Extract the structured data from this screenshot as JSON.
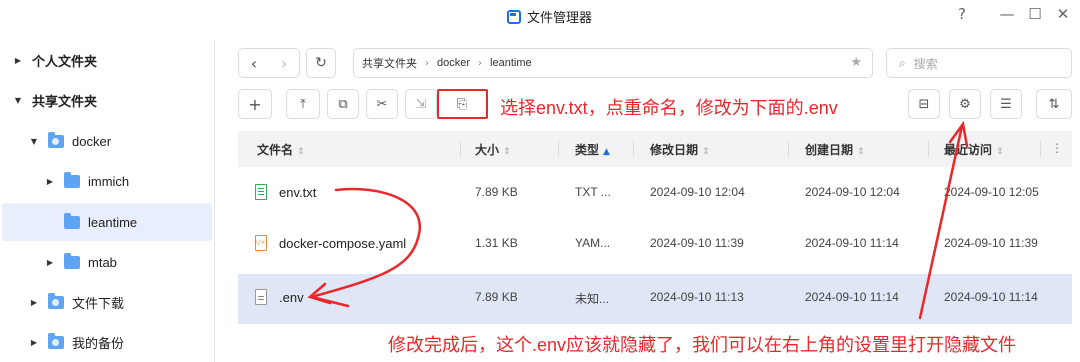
{
  "window": {
    "title": "文件管理器",
    "controls": [
      "?",
      "—",
      "☐",
      "✕"
    ]
  },
  "sidebar": {
    "items": [
      {
        "label": "个人文件夹",
        "arrow": "▶",
        "icon": "none"
      },
      {
        "label": "共享文件夹",
        "arrow": "▼",
        "icon": "none"
      },
      {
        "label": "docker",
        "arrow": "▼",
        "icon": "shared-folder-icon"
      },
      {
        "label": "immich",
        "arrow": "▶",
        "icon": "folder-icon"
      },
      {
        "label": "leantime",
        "arrow": "",
        "icon": "folder-icon"
      },
      {
        "label": "mtab",
        "arrow": "▶",
        "icon": "folder-icon"
      },
      {
        "label": "文件下载",
        "arrow": "▶",
        "icon": "shared-folder-icon"
      },
      {
        "label": "我的备份",
        "arrow": "▶",
        "icon": "shared-folder-icon"
      }
    ]
  },
  "nav": {
    "back": "‹",
    "forward": "›",
    "refresh": "↻"
  },
  "breadcrumb": {
    "items": [
      "共享文件夹",
      "docker",
      "leantime"
    ],
    "separator": "›",
    "star": "★"
  },
  "search": {
    "placeholder": "搜索",
    "icon": "⌕"
  },
  "toolbar": {
    "new": "+",
    "upload": "⤒",
    "copy": "⧉",
    "cut": "✂",
    "move": "⇲",
    "rename": "⎘",
    "view": "⊟",
    "settings": "⚙",
    "list": "☰",
    "sort": "⇅"
  },
  "annotations": {
    "top": "选择env.txt，点重命名，修改为下面的.env",
    "bottom": "修改完成后，这个.env应该就隐藏了，我们可以在右上角的设置里打开隐藏文件"
  },
  "table": {
    "columns": [
      "文件名",
      "大小",
      "类型",
      "修改日期",
      "创建日期",
      "最近访问"
    ],
    "sort_icon": "⇕",
    "sort_active_icon": "▲",
    "more": "⋮",
    "rows": [
      {
        "name": "env.txt",
        "size": "7.89 KB",
        "type": "TXT ...",
        "modified": "2024-09-10 12:04",
        "created": "2024-09-10 12:04",
        "accessed": "2024-09-10 12:05",
        "icon": "txt"
      },
      {
        "name": "docker-compose.yaml",
        "size": "1.31 KB",
        "type": "YAM...",
        "modified": "2024-09-10 11:39",
        "created": "2024-09-10 11:14",
        "accessed": "2024-09-10 11:39",
        "icon": "yaml"
      },
      {
        "name": ".env",
        "size": "7.89 KB",
        "type": "未知...",
        "modified": "2024-09-10 11:13",
        "created": "2024-09-10 11:14",
        "accessed": "2024-09-10 11:14",
        "icon": "env"
      }
    ]
  },
  "colors": {
    "annotation": "#e8282b",
    "accent": "#1e6fe0",
    "selected_row": "#dfe6f6"
  }
}
